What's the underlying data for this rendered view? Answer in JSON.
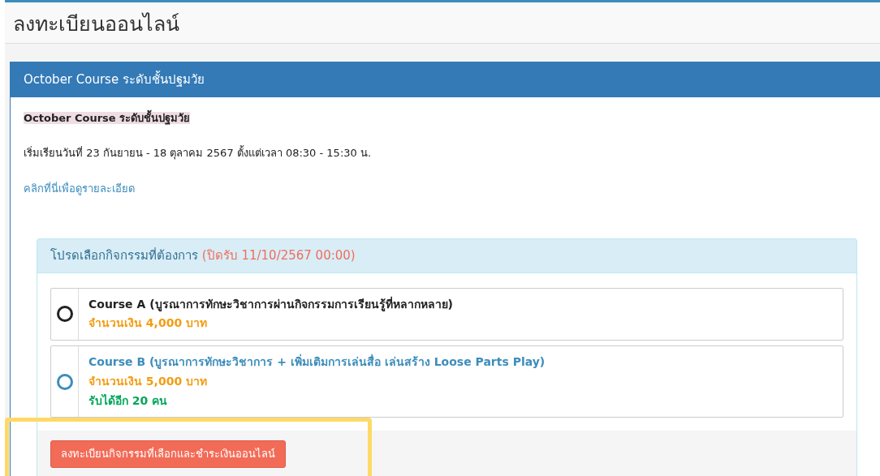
{
  "page_title": "ลงทะเบียนออนไลน์",
  "course_card": {
    "title": "October Course ระดับชั้นปฐมวัย",
    "highlighted_name": "October Course ระดับชั้นปฐมวัย",
    "schedule": "เริ่มเรียนวันที่ 23 กันยายน - 18 ตุลาคม 2567 ตั้งแต่เวลา 08:30 - 15:30 น.",
    "details_link": "คลิกที่นี่เพื่อดูรายละเอียด"
  },
  "activity_panel": {
    "heading": "โปรดเลือกกิจกรรมที่ต้องการ",
    "deadline": "(ปิดรับ 11/10/2567 00:00)",
    "options": [
      {
        "name": "Course A (บูรณาการทักษะวิชาการผ่านกิจกรรมการเรียนรู้ที่หลากหลาย)",
        "price": "จำนวนเงิน 4,000 บาท",
        "selected": false,
        "hovered": true
      },
      {
        "name": "Course B (บูรณาการทักษะวิชาการ + เพิ่มเติมการเล่นสื่อ เล่นสร้าง Loose Parts Play)",
        "price": "จำนวนเงิน 5,000 บาท",
        "seats": "รับได้อีก 20 คน",
        "selected": false,
        "hovered": false
      }
    ],
    "submit_button": "ลงทะเบียนกิจกรรมที่เลือกและชำระเงินออนไลน์"
  },
  "annotation_frame": true
}
